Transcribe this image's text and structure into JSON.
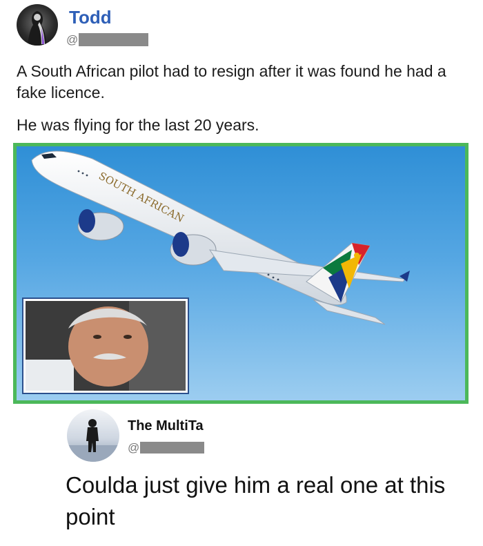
{
  "tweet": {
    "author_name": "Todd",
    "author_handle_prefix": "@",
    "paragraph_1": "A South African pilot had to resign after it was found he had a fake licence.",
    "paragraph_2": "He was flying for the last 20 years."
  },
  "image": {
    "airline_livery": "SOUTH AFRICAN",
    "frame_color": "#4cb85a"
  },
  "reply": {
    "author_name": "The MultiTa",
    "author_handle_prefix": "@",
    "text": "Coulda just give him a real one at this point"
  }
}
